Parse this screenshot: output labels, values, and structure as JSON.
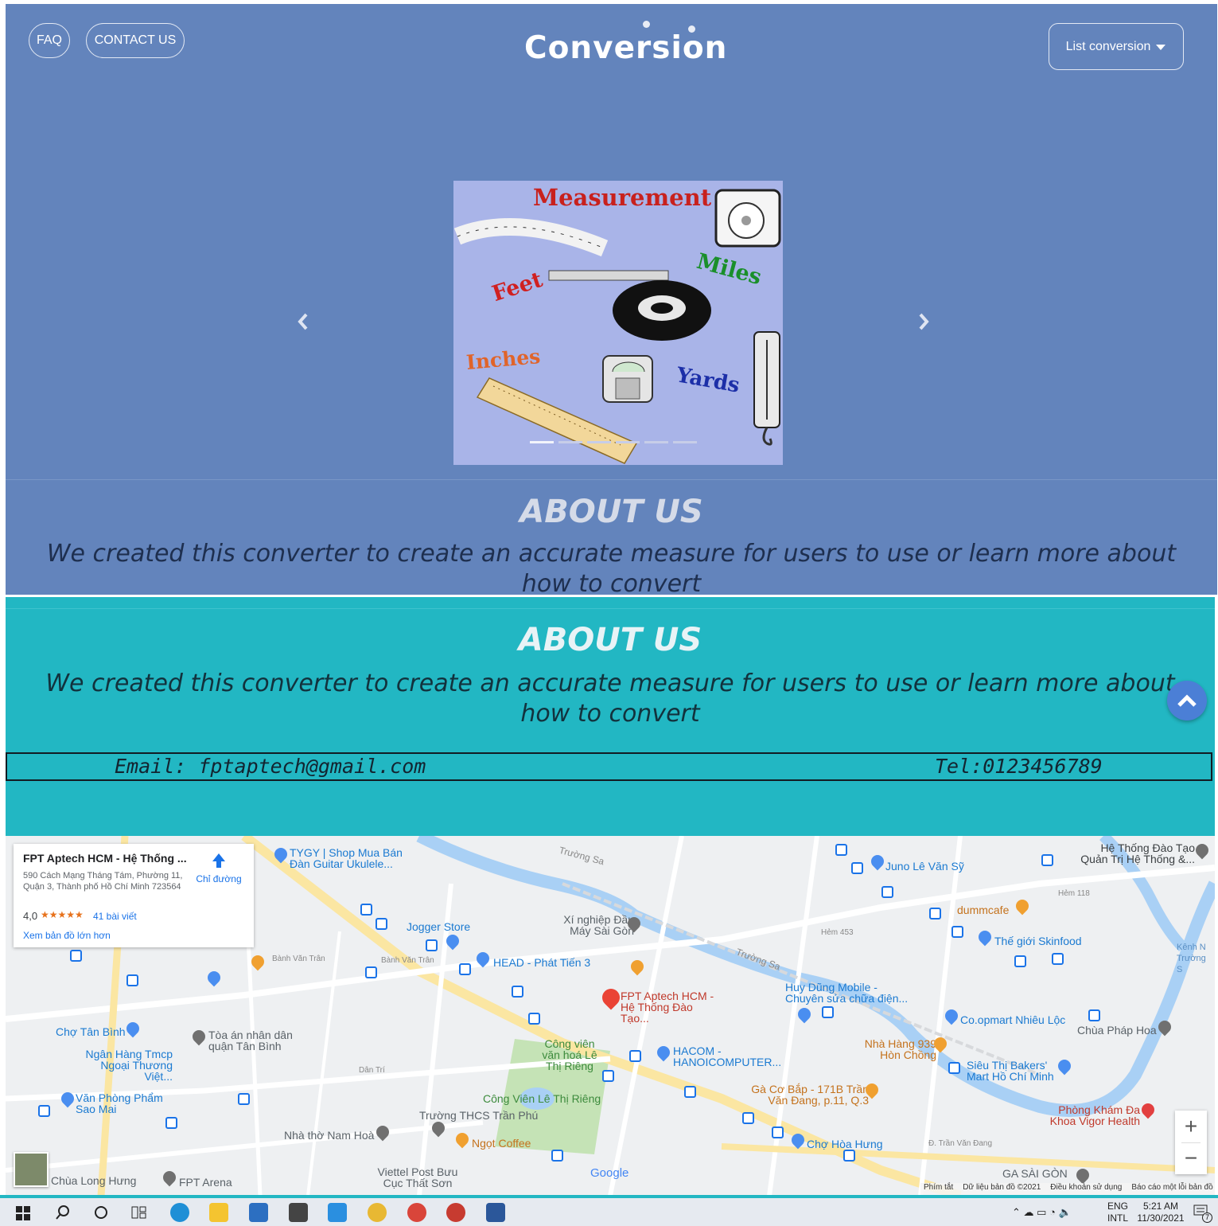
{
  "nav": {
    "faq": "FAQ",
    "contact": "CONTACT US",
    "brand": "Conversion",
    "list_conversion": "List conversion"
  },
  "slide": {
    "title": "Measurement",
    "words": [
      "Miles",
      "Feet",
      "Inches",
      "Yards"
    ]
  },
  "about": {
    "title": "ABOUT US",
    "text": "We created this converter to create an accurate measure for users to use or learn more about how to convert"
  },
  "contact": {
    "email": "Email: fptaptech@gmail.com",
    "tel": "Tel:0123456789"
  },
  "map": {
    "card": {
      "name": "FPT Aptech HCM - Hệ Thống ...",
      "address": "590 Cách Mạng Tháng Tám, Phường 11, Quận 3, Thành phố Hồ Chí Minh 723564",
      "rating": "4,0",
      "stars": "★★★★★",
      "reviews": "41 bài viết",
      "directions": "Chỉ đường",
      "larger": "Xem bản đồ lớn hơn"
    },
    "labels": {
      "tygy": "TYGY | Shop Mua Bán Đàn Guitar Ukulele...",
      "juno": "Juno Lê Văn Sỹ",
      "he_thong": "Hệ Thống Đào Tạo Quản Trị Hệ Thống &...",
      "dummcafe": "dummcafe",
      "jogger": "Jogger Store",
      "xi_nghiep": "Xí nghiệp Đầu Máy Sài Gòn",
      "skinfood": "Thế giới Skinfood",
      "head": "HEAD - Phát Tiến 3",
      "fpt": "FPT Aptech HCM - Hệ Thống Đào Tạo...",
      "huy_dung": "Huy Dũng Mobile - Chuyên sửa chữa điện...",
      "coopmart": "Co.opmart Nhiêu Lộc",
      "cho_tan_binh": "Chợ Tân Bình",
      "toa_an": "Tòa án nhân dân quận Tân Bình",
      "chua_phap_hoa": "Chùa Pháp Hoa",
      "ngan_hang": "Ngân Hàng Tmcp Ngoại Thương Việt...",
      "cong_vien_le": "Công viên văn hoá Lê Thị Riêng",
      "nha_hang": "Nhà Hàng 939 Hòn Chồng",
      "hacom": "HACOM - HANOICOMPUTER...",
      "sieu_thi": "Siêu Thị Bakers' Mart Hồ Chí Minh",
      "van_phong": "Văn Phòng Phẩm Sao Mai",
      "cong_vien": "Công Viên Lê Thị Riêng",
      "ga_co": "Gà Cơ Bắp - 171B Trần Văn Đang, p.11, Q.3",
      "thcs": "Trường THCS Trần Phú",
      "phong_kham": "Phòng Khám Đa Khoa Vigor Health",
      "nha_tho": "Nhà thờ Nam Hoà",
      "ngot": "Ngọt Coffee",
      "cho_hoa_hung": "Chợ Hòa Hưng",
      "chua_long_hung": "Chùa Long Hưng",
      "fpt_arena": "FPT Arena",
      "viettel": "Viettel Post Bưu Cục Thất Sơn",
      "google": "Google",
      "ga_sai_gon": "GA SÀI GÒN",
      "truong_sa": "Trường Sa",
      "banh_van_tran": "Bành Văn Trân",
      "dan_tri": "Dân Trí",
      "tran_van_dang": "Đ. Trần Văn Đang",
      "hem_118": "Hẻm 118",
      "hem_453": "Hẻm 453",
      "kenh": "Kênh N Trường S"
    },
    "footer": {
      "shortcuts": "Phím tắt",
      "data": "Dữ liệu bản đồ ©2021",
      "terms": "Điều khoản sử dụng",
      "report": "Báo cáo một lỗi bản đồ"
    },
    "zoom_in": "+",
    "zoom_out": "−"
  },
  "taskbar": {
    "lang1": "ENG",
    "lang2": "INTL",
    "time": "5:21 AM",
    "date": "11/30/2021",
    "notif": "7"
  }
}
